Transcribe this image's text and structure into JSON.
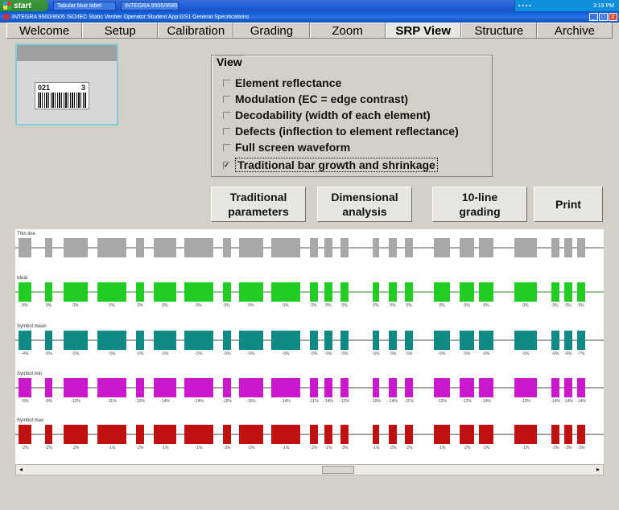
{
  "taskbar": {
    "start_label": "start",
    "tasks": [
      "Tabular blue label",
      "INTEGRA 9505/9585"
    ],
    "clock": "3:19 PM"
  },
  "window": {
    "title": "INTEGRA 9500/9505 ISO/IEC Static Verifier   Operator:Student   App:GS1 General Specifications",
    "minimize": "_",
    "maximize": "□",
    "close": "X"
  },
  "tabs": [
    "Welcome",
    "Setup",
    "Calibration",
    "Grading",
    "Zoom",
    "SRP View",
    "Structure",
    "Archive"
  ],
  "active_tab": "SRP View",
  "thumbnail": {
    "label_number": "021",
    "label_number_right": "3"
  },
  "view": {
    "legend": "View",
    "options": [
      {
        "label": "Element reflectance",
        "checked": false
      },
      {
        "label": "Modulation (EC = edge contrast)",
        "checked": false
      },
      {
        "label": "Decodability (width of each element)",
        "checked": false
      },
      {
        "label": "Defects (inflection to element reflectance)",
        "checked": false
      },
      {
        "label": "Full screen waveform",
        "checked": false
      },
      {
        "label": "Traditional bar growth and shrinkage",
        "checked": true
      }
    ]
  },
  "buttons": {
    "traditional": "Traditional\nparameters",
    "dimensional": "Dimensional\nanalysis",
    "tenline": "10-line\ngrading",
    "print": "Print"
  },
  "chart_data": {
    "type": "bar",
    "colors": {
      "thin_line": "#a8a8a8",
      "ideal": "#22cc22",
      "symbol_mean": "#0f8a86",
      "symbol_min": "#cc18cc",
      "symbol_max": "#c01010"
    },
    "rows": [
      {
        "name": "Thin line",
        "color": "thin_line",
        "labels": []
      },
      {
        "name": "Ideal",
        "color": "ideal",
        "labels": [
          "0%",
          "0%",
          "0%",
          "0%",
          "0%",
          "0%",
          "0%",
          "0%",
          "0%",
          "0%",
          "0%",
          "0%",
          "0%",
          "0%",
          "0%",
          "0%",
          "0%",
          "0%",
          "0%",
          "0%",
          "0%",
          "0%",
          "0%"
        ]
      },
      {
        "name": "Symbol mean",
        "color": "symbol_mean",
        "labels": [
          "-4%",
          "-5%",
          "-5%",
          "-5%",
          "-5%",
          "-5%",
          "-5%",
          "-5%",
          "-5%",
          "-5%",
          "-5%",
          "-5%",
          "-5%",
          "-5%",
          "-5%",
          "-5%",
          "-6%",
          "-5%",
          "-6%",
          "-6%",
          "-6%",
          "-6%",
          "-7%"
        ]
      },
      {
        "name": "Symbol min",
        "color": "symbol_min",
        "labels": [
          "-5%",
          "-9%",
          "-12%",
          "-11%",
          "-10%",
          "-14%",
          "-14%",
          "-15%",
          "-15%",
          "-14%",
          "-11%",
          "-14%",
          "-12%",
          "-16%",
          "-14%",
          "-11%",
          "-12%",
          "-12%",
          "-14%",
          "-12%",
          "-14%",
          "-14%",
          "-14%"
        ]
      },
      {
        "name": "Symbol max",
        "color": "symbol_max",
        "labels": [
          "-2%",
          "-2%",
          "-2%",
          "-1%",
          "-2%",
          "-1%",
          "-1%",
          "-3%",
          "-1%",
          "-1%",
          "-2%",
          "-1%",
          "-3%",
          "-1%",
          "-2%",
          "-2%",
          "-1%",
          "-2%",
          "-2%",
          "-1%",
          "-3%",
          "-3%",
          "-3%"
        ]
      }
    ]
  }
}
